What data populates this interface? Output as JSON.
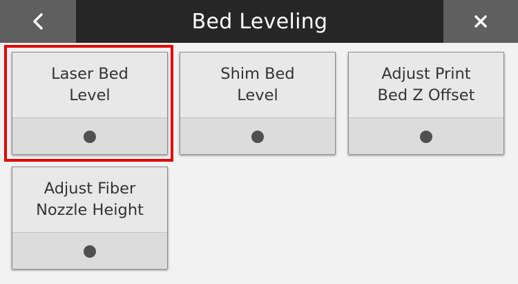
{
  "header": {
    "title": "Bed Leveling",
    "back_icon": "chevron-left-icon",
    "close_icon": "close-icon"
  },
  "selected_tile": "Laser Bed Level",
  "colors": {
    "header_bg": "#262626",
    "header_button_bg": "#5f5f5f",
    "selection_border": "#e00000",
    "tile_bg": "#e8e8e8",
    "page_bg": "#f2f2f2"
  },
  "tiles": [
    {
      "label": "Laser Bed\nLevel",
      "indicator_icon": "dot-indicator-icon"
    },
    {
      "label": "Shim Bed\nLevel",
      "indicator_icon": "dot-indicator-icon"
    },
    {
      "label": "Adjust Print\nBed Z Offset",
      "indicator_icon": "dot-indicator-icon"
    },
    {
      "label": "Adjust Fiber\nNozzle Height",
      "indicator_icon": "dot-indicator-icon"
    }
  ]
}
